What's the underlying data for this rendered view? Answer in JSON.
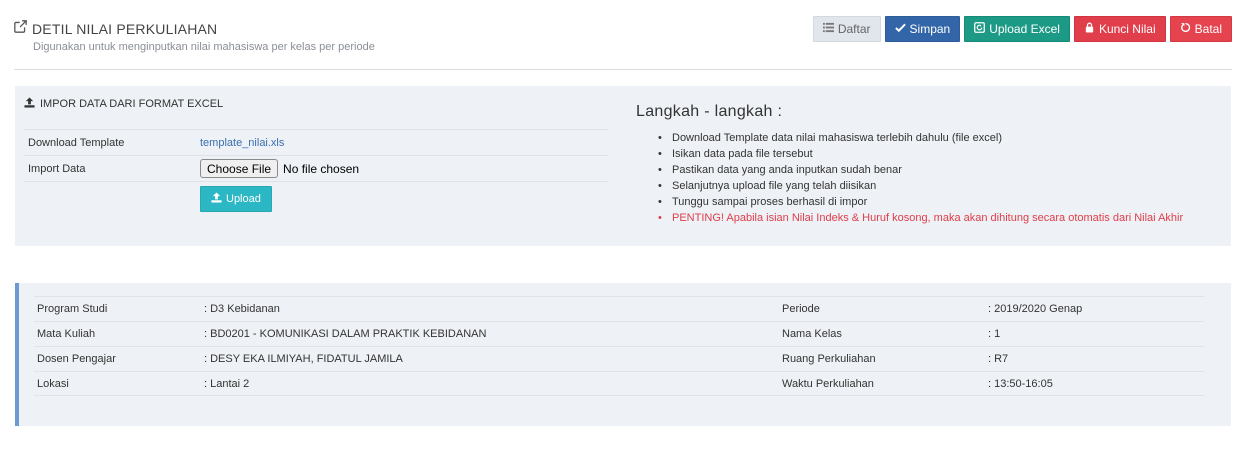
{
  "header": {
    "title": "DETIL NILAI PERKULIAHAN",
    "subtitle": "Digunakan untuk menginputkan nilai mahasiswa per kelas per periode"
  },
  "actions": {
    "list_label": "Daftar",
    "save_label": "Simpan",
    "upload_excel_label": "Upload Excel",
    "lock_label": "Kunci Nilai",
    "cancel_label": "Batal"
  },
  "import": {
    "title": "IMPOR DATA DARI FORMAT EXCEL",
    "template_label": "Download Template",
    "template_file": "template_nilai.xls",
    "import_label": "Import Data",
    "choose_file_label": "Choose File",
    "no_file_text": "No file chosen",
    "upload_label": "Upload"
  },
  "steps": {
    "title": "Langkah - langkah :",
    "items": [
      "Download Template data nilai mahasiswa terlebih dahulu (file excel)",
      "Isikan data pada file tersebut",
      "Pastikan data yang anda inputkan sudah benar",
      "Selanjutnya upload file yang telah diisikan",
      "Tunggu sampai proses berhasil di impor"
    ],
    "warning": "PENTING! Apabila isian Nilai Indeks & Huruf kosong, maka akan dihitung secara otomatis dari Nilai Akhir"
  },
  "info": {
    "rows": [
      {
        "l1": "Program Studi",
        "v1": ": D3 Kebidanan",
        "l2": "Periode",
        "v2": ": 2019/2020 Genap"
      },
      {
        "l1": "Mata Kuliah",
        "v1": ": BD0201 - KOMUNIKASI DALAM PRAKTIK KEBIDANAN",
        "l2": "Nama Kelas",
        "v2": ": 1"
      },
      {
        "l1": "Dosen Pengajar",
        "v1": ": DESY EKA ILMIYAH, FIDATUL JAMILA",
        "l2": "Ruang Perkuliahan",
        "v2": ": R7"
      },
      {
        "l1": "Lokasi",
        "v1": ": Lantai 2",
        "l2": "Waktu Perkuliahan",
        "v2": ": 13:50-16:05"
      }
    ]
  },
  "colors": {
    "save": "#3366a8",
    "upload_excel": "#1d9a86",
    "lock": "#e03e4a",
    "cancel": "#e5434e",
    "upload": "#2bb8c4",
    "accent_border": "#6b9bd1"
  },
  "icons": {
    "title": "external-link-icon",
    "list": "list-icon",
    "save": "check-icon",
    "upload_excel": "refresh-icon",
    "lock": "lock-icon",
    "cancel": "undo-icon",
    "import": "upload-icon"
  }
}
